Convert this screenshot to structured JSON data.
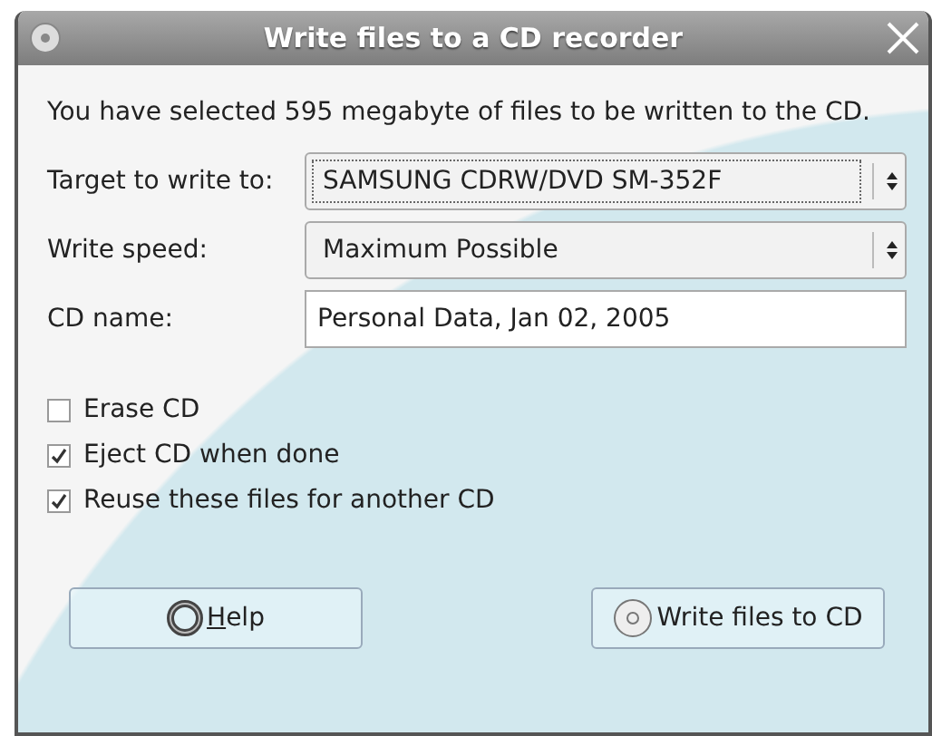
{
  "window": {
    "title": "Write files to a CD recorder"
  },
  "message": "You have selected 595 megabyte of files to be written to the CD.",
  "fields": [
    {
      "kind": "combo",
      "label": "Target to write to:",
      "value": "SAMSUNG CDRW/DVD SM-352F",
      "focused": true
    },
    {
      "kind": "combo",
      "label": "Write speed:",
      "value": "Maximum Possible",
      "focused": false
    },
    {
      "kind": "entry",
      "label": "CD name:",
      "value": "Personal Data, Jan 02, 2005",
      "focused": false
    }
  ],
  "options": [
    {
      "label": "Erase CD",
      "checked": false
    },
    {
      "label": "Eject CD when done",
      "checked": true
    },
    {
      "label": "Reuse these files for another CD",
      "checked": true
    }
  ],
  "buttons": [
    {
      "kind": "help",
      "label": "Help"
    },
    {
      "kind": "write",
      "label": "Write files to CD"
    }
  ]
}
